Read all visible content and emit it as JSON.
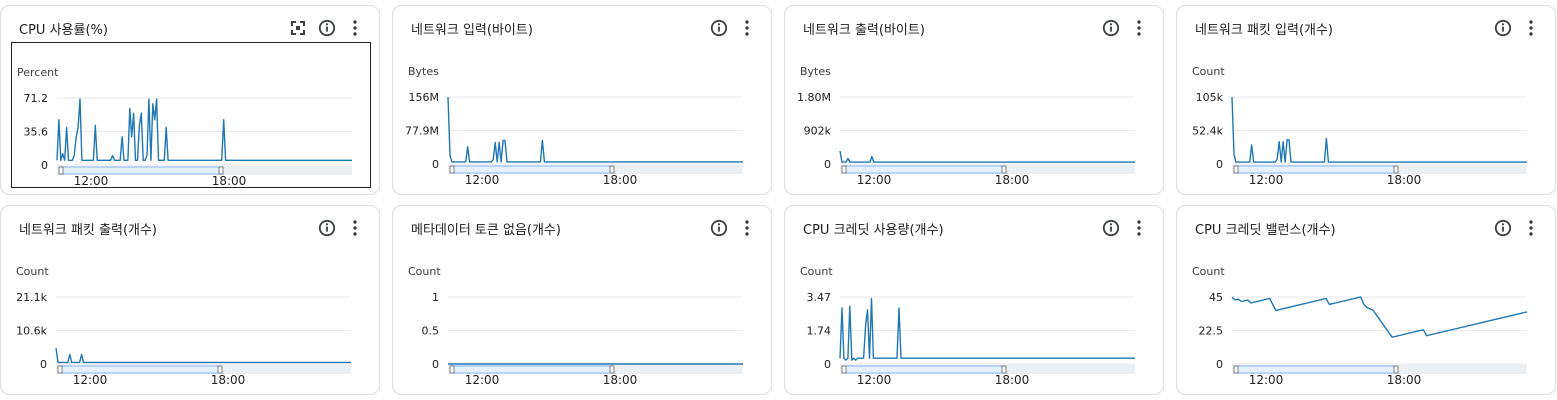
{
  "cards": [
    {
      "title": "CPU 사용률(%)",
      "has_fullscreen": true,
      "selected": true,
      "chart_data": {
        "type": "line",
        "ylabel": "Percent",
        "yticks": [
          "71.2",
          "35.6",
          "0"
        ],
        "ylim": [
          0,
          71.2
        ],
        "xticks": [
          "12:00",
          "18:00"
        ],
        "values": [
          5,
          48,
          5,
          12,
          5,
          40,
          5,
          5,
          5,
          10,
          30,
          40,
          70,
          5,
          5,
          5,
          5,
          5,
          5,
          5,
          42,
          5,
          5,
          5,
          5,
          5,
          5,
          5,
          5,
          10,
          5,
          5,
          5,
          5,
          30,
          5,
          5,
          5,
          60,
          30,
          55,
          5,
          5,
          42,
          55,
          5,
          5,
          10,
          70,
          5,
          65,
          48,
          70,
          5,
          5,
          5,
          5,
          40,
          5,
          5,
          5,
          5,
          5,
          5,
          5,
          5,
          5,
          5,
          5,
          5,
          5,
          5,
          5,
          5,
          5,
          5,
          5,
          5,
          5,
          5,
          5,
          5,
          5,
          5,
          5,
          5,
          5,
          48,
          5,
          5,
          5,
          5,
          5,
          5,
          5,
          5,
          5,
          5,
          5,
          5,
          5,
          5,
          5,
          5,
          5,
          5,
          5,
          5,
          5,
          5,
          5,
          5,
          5,
          5,
          5,
          5,
          5,
          5,
          5,
          5,
          5,
          5,
          5,
          5,
          5,
          5,
          5,
          5,
          5,
          5,
          5,
          5,
          5,
          5,
          5,
          5,
          5,
          5,
          5,
          5,
          5,
          5,
          5,
          5,
          5,
          5,
          5,
          5,
          5,
          5,
          5,
          5,
          5,
          5,
          5
        ]
      }
    },
    {
      "title": "네트워크 입력(바이트)",
      "has_fullscreen": false,
      "selected": false,
      "chart_data": {
        "type": "line",
        "ylabel": "Bytes",
        "yticks": [
          "156M",
          "77.9M",
          "0"
        ],
        "ylim": [
          0,
          156
        ],
        "xticks": [
          "12:00",
          "18:00"
        ],
        "values": [
          156,
          20,
          5,
          5,
          5,
          5,
          5,
          5,
          5,
          5,
          40,
          5,
          5,
          5,
          5,
          5,
          5,
          5,
          5,
          5,
          5,
          5,
          5,
          10,
          50,
          5,
          50,
          5,
          55,
          55,
          5,
          5,
          5,
          5,
          5,
          5,
          5,
          5,
          5,
          5,
          5,
          5,
          5,
          5,
          5,
          5,
          5,
          5,
          55,
          5,
          5,
          5,
          5,
          5,
          5,
          5,
          5,
          5,
          5,
          5,
          5,
          5,
          5,
          5,
          5,
          5,
          5,
          5,
          5,
          5,
          5,
          5,
          5,
          5,
          5,
          5,
          5,
          5,
          5,
          5,
          5,
          5,
          5,
          5,
          5,
          5,
          5,
          5,
          5,
          5,
          5,
          5,
          5,
          5,
          5,
          5,
          5,
          5,
          5,
          5,
          5,
          5,
          5,
          5,
          5,
          5,
          5,
          5,
          5,
          5,
          5,
          5,
          5,
          5,
          5,
          5,
          5,
          5,
          5,
          5,
          5,
          5,
          5,
          5,
          5,
          5,
          5,
          5,
          5,
          5,
          5,
          5,
          5,
          5,
          5,
          5,
          5,
          5,
          5,
          5,
          5,
          5,
          5,
          5,
          5,
          5,
          5,
          5,
          5,
          5,
          5
        ]
      }
    },
    {
      "title": "네트워크 출력(바이트)",
      "has_fullscreen": false,
      "selected": false,
      "chart_data": {
        "type": "line",
        "ylabel": "Bytes",
        "yticks": [
          "1.80M",
          "902k",
          "0"
        ],
        "ylim": [
          0,
          1.8
        ],
        "xticks": [
          "12:00",
          "18:00"
        ],
        "values": [
          0.35,
          0.05,
          0.05,
          0.05,
          0.15,
          0.05,
          0.05,
          0.05,
          0.05,
          0.05,
          0.05,
          0.05,
          0.05,
          0.05,
          0.05,
          0.05,
          0.2,
          0.05,
          0.05,
          0.05,
          0.05,
          0.05,
          0.05,
          0.05,
          0.05,
          0.05,
          0.05,
          0.05,
          0.05,
          0.05,
          0.05,
          0.05,
          0.05,
          0.05,
          0.05,
          0.05,
          0.05,
          0.05,
          0.05,
          0.05,
          0.05,
          0.05,
          0.05,
          0.05,
          0.05,
          0.05,
          0.05,
          0.05,
          0.05,
          0.05,
          0.05,
          0.05,
          0.05,
          0.05,
          0.05,
          0.05,
          0.05,
          0.05,
          0.05,
          0.05,
          0.05,
          0.05,
          0.05,
          0.05,
          0.05,
          0.05,
          0.05,
          0.05,
          0.05,
          0.05,
          0.05,
          0.05,
          0.05,
          0.05,
          0.05,
          0.05,
          0.05,
          0.05,
          0.05,
          0.05,
          0.05,
          0.05,
          0.05,
          0.05,
          0.05,
          0.05,
          0.05,
          0.05,
          0.05,
          0.05,
          0.05,
          0.05,
          0.05,
          0.05,
          0.05,
          0.05,
          0.05,
          0.05,
          0.05,
          0.05,
          0.05,
          0.05,
          0.05,
          0.05,
          0.05,
          0.05,
          0.05,
          0.05,
          0.05,
          0.05,
          0.05,
          0.05,
          0.05,
          0.05,
          0.05,
          0.05,
          0.05,
          0.05,
          0.05,
          0.05,
          0.05,
          0.05,
          0.05,
          0.05,
          0.05,
          0.05,
          0.05,
          0.05,
          0.05,
          0.05,
          0.05,
          0.05,
          0.05,
          0.05,
          0.05,
          0.05,
          0.05,
          0.05,
          0.05,
          0.05,
          0.05,
          0.05,
          0.05,
          0.05,
          0.05,
          0.05,
          0.05,
          0.05,
          0.05
        ]
      }
    },
    {
      "title": "네트워크 패킷 입력(개수)",
      "has_fullscreen": false,
      "selected": false,
      "chart_data": {
        "type": "line",
        "ylabel": "Count",
        "yticks": [
          "105k",
          "52.4k",
          "0"
        ],
        "ylim": [
          0,
          105
        ],
        "xticks": [
          "12:00",
          "18:00"
        ],
        "values": [
          105,
          15,
          3,
          3,
          3,
          3,
          3,
          3,
          3,
          3,
          30,
          3,
          3,
          3,
          3,
          3,
          3,
          3,
          3,
          3,
          3,
          3,
          3,
          8,
          35,
          3,
          35,
          3,
          38,
          38,
          3,
          3,
          3,
          3,
          3,
          3,
          3,
          3,
          3,
          3,
          3,
          3,
          3,
          3,
          3,
          3,
          3,
          3,
          40,
          3,
          3,
          3,
          3,
          3,
          3,
          3,
          3,
          3,
          3,
          3,
          3,
          3,
          3,
          3,
          3,
          3,
          3,
          3,
          3,
          3,
          3,
          3,
          3,
          3,
          3,
          3,
          3,
          3,
          3,
          3,
          3,
          3,
          3,
          3,
          3,
          3,
          3,
          3,
          3,
          3,
          3,
          3,
          3,
          3,
          3,
          3,
          3,
          3,
          3,
          3,
          3,
          3,
          3,
          3,
          3,
          3,
          3,
          3,
          3,
          3,
          3,
          3,
          3,
          3,
          3,
          3,
          3,
          3,
          3,
          3,
          3,
          3,
          3,
          3,
          3,
          3,
          3,
          3,
          3,
          3,
          3,
          3,
          3,
          3,
          3,
          3,
          3,
          3,
          3,
          3,
          3,
          3,
          3,
          3,
          3,
          3,
          3,
          3,
          3,
          3,
          3
        ]
      }
    },
    {
      "title": "네트워크 패킷 출력(개수)",
      "has_fullscreen": false,
      "selected": false,
      "chart_data": {
        "type": "line",
        "ylabel": "Count",
        "yticks": [
          "21.1k",
          "10.6k",
          "0"
        ],
        "ylim": [
          0,
          21.1
        ],
        "xticks": [
          "12:00",
          "18:00"
        ],
        "values": [
          5,
          0.5,
          0.5,
          0.5,
          0.5,
          0.5,
          0.5,
          3,
          0.5,
          0.5,
          0.5,
          0.5,
          0.5,
          3,
          0.5,
          0.5,
          0.5,
          0.5,
          0.5,
          0.5,
          0.5,
          0.5,
          0.5,
          0.5,
          0.5,
          0.5,
          0.5,
          0.5,
          0.5,
          0.5,
          0.5,
          0.5,
          0.5,
          0.5,
          0.5,
          0.5,
          0.5,
          0.5,
          0.5,
          0.5,
          0.5,
          0.5,
          0.5,
          0.5,
          0.5,
          0.5,
          0.5,
          0.5,
          0.5,
          0.5,
          0.5,
          0.5,
          0.5,
          0.5,
          0.5,
          0.5,
          0.5,
          0.5,
          0.5,
          0.5,
          0.5,
          0.5,
          0.5,
          0.5,
          0.5,
          0.5,
          0.5,
          0.5,
          0.5,
          0.5,
          0.5,
          0.5,
          0.5,
          0.5,
          0.5,
          0.5,
          0.5,
          0.5,
          0.5,
          0.5,
          0.5,
          0.5,
          0.5,
          0.5,
          0.5,
          0.5,
          0.5,
          0.5,
          0.5,
          0.5,
          0.5,
          0.5,
          0.5,
          0.5,
          0.5,
          0.5,
          0.5,
          0.5,
          0.5,
          0.5,
          0.5,
          0.5,
          0.5,
          0.5,
          0.5,
          0.5,
          0.5,
          0.5,
          0.5,
          0.5,
          0.5,
          0.5,
          0.5,
          0.5,
          0.5,
          0.5,
          0.5,
          0.5,
          0.5,
          0.5,
          0.5,
          0.5,
          0.5,
          0.5,
          0.5,
          0.5,
          0.5,
          0.5,
          0.5,
          0.5,
          0.5,
          0.5,
          0.5,
          0.5,
          0.5,
          0.5,
          0.5,
          0.5,
          0.5,
          0.5,
          0.5,
          0.5,
          0.5,
          0.5,
          0.5,
          0.5,
          0.5,
          0.5,
          0.5,
          0.5,
          0.5
        ]
      }
    },
    {
      "title": "메타데이터 토큰 없음(개수)",
      "has_fullscreen": false,
      "selected": false,
      "chart_data": {
        "type": "line",
        "ylabel": "Count",
        "yticks": [
          "1",
          "0.5",
          "0"
        ],
        "ylim": [
          0,
          1
        ],
        "xticks": [
          "12:00",
          "18:00"
        ],
        "values": [
          0,
          0,
          0,
          0,
          0,
          0,
          0,
          0,
          0,
          0,
          0,
          0,
          0,
          0,
          0,
          0,
          0,
          0,
          0,
          0,
          0,
          0,
          0,
          0,
          0,
          0,
          0,
          0,
          0,
          0,
          0,
          0,
          0,
          0,
          0,
          0,
          0,
          0,
          0,
          0,
          0,
          0,
          0,
          0,
          0,
          0,
          0,
          0,
          0,
          0,
          0,
          0,
          0,
          0,
          0,
          0,
          0,
          0,
          0,
          0,
          0,
          0,
          0,
          0,
          0,
          0,
          0,
          0,
          0,
          0,
          0,
          0,
          0,
          0,
          0,
          0,
          0,
          0,
          0,
          0,
          0,
          0,
          0,
          0,
          0,
          0,
          0,
          0,
          0,
          0,
          0,
          0,
          0,
          0,
          0,
          0,
          0,
          0,
          0,
          0,
          0,
          0,
          0,
          0,
          0,
          0,
          0,
          0,
          0,
          0,
          0,
          0,
          0,
          0,
          0,
          0,
          0,
          0,
          0,
          0,
          0,
          0,
          0,
          0,
          0,
          0,
          0,
          0,
          0,
          0,
          0,
          0,
          0,
          0,
          0,
          0,
          0,
          0,
          0,
          0,
          0,
          0,
          0,
          0,
          0,
          0,
          0,
          0,
          0,
          0,
          0
        ]
      }
    },
    {
      "title": "CPU 크레딧 사용량(개수)",
      "has_fullscreen": false,
      "selected": false,
      "chart_data": {
        "type": "line",
        "ylabel": "Count",
        "yticks": [
          "3.47",
          "1.74",
          "0"
        ],
        "ylim": [
          0,
          3.47
        ],
        "xticks": [
          "12:00",
          "18:00"
        ],
        "values": [
          0.3,
          2.9,
          0.3,
          0.2,
          0.3,
          3.0,
          0.2,
          0.3,
          0.2,
          0.3,
          0.3,
          0.3,
          0.3,
          2.0,
          2.8,
          0.3,
          3.4,
          0.3,
          0.3,
          0.3,
          0.3,
          0.3,
          0.3,
          0.3,
          0.3,
          0.3,
          0.3,
          0.3,
          0.3,
          0.3,
          2.9,
          0.3,
          0.3,
          0.3,
          0.3,
          0.3,
          0.3,
          0.3,
          0.3,
          0.3,
          0.3,
          0.3,
          0.3,
          0.3,
          0.3,
          0.3,
          0.3,
          0.3,
          0.3,
          0.3,
          0.3,
          0.3,
          0.3,
          0.3,
          0.3,
          0.3,
          0.3,
          0.3,
          0.3,
          0.3,
          0.3,
          0.3,
          0.3,
          0.3,
          0.3,
          0.3,
          0.3,
          0.3,
          0.3,
          0.3,
          0.3,
          0.3,
          0.3,
          0.3,
          0.3,
          0.3,
          0.3,
          0.3,
          0.3,
          0.3,
          0.3,
          0.3,
          0.3,
          0.3,
          0.3,
          0.3,
          0.3,
          0.3,
          0.3,
          0.3,
          0.3,
          0.3,
          0.3,
          0.3,
          0.3,
          0.3,
          0.3,
          0.3,
          0.3,
          0.3,
          0.3,
          0.3,
          0.3,
          0.3,
          0.3,
          0.3,
          0.3,
          0.3,
          0.3,
          0.3,
          0.3,
          0.3,
          0.3,
          0.3,
          0.3,
          0.3,
          0.3,
          0.3,
          0.3,
          0.3,
          0.3,
          0.3,
          0.3,
          0.3,
          0.3,
          0.3,
          0.3,
          0.3,
          0.3,
          0.3,
          0.3,
          0.3,
          0.3,
          0.3,
          0.3,
          0.3,
          0.3,
          0.3,
          0.3,
          0.3,
          0.3,
          0.3,
          0.3,
          0.3,
          0.3,
          0.3,
          0.3,
          0.3,
          0.3,
          0.3,
          0.3
        ]
      }
    },
    {
      "title": "CPU 크레딧 밸런스(개수)",
      "has_fullscreen": false,
      "selected": false,
      "chart_data": {
        "type": "line",
        "ylabel": "Count",
        "yticks": [
          "45",
          "22.5",
          "0"
        ],
        "ylim": [
          0,
          45
        ],
        "xticks": [
          "12:00",
          "18:00"
        ],
        "values": [
          45,
          43,
          43.5,
          42,
          42.5,
          43,
          41,
          41.5,
          42,
          42.5,
          43,
          43.5,
          44,
          40,
          36,
          36.5,
          37,
          37.5,
          38,
          38.5,
          39,
          39.5,
          40,
          40.5,
          41,
          41.5,
          42,
          42.5,
          43,
          43.5,
          44,
          40,
          40.5,
          41,
          41.5,
          42,
          42.5,
          43,
          43.5,
          44,
          44.5,
          45,
          40,
          38,
          37,
          36,
          33,
          30,
          27,
          24,
          21,
          18,
          18.5,
          19,
          19.5,
          20,
          20.5,
          21,
          21.5,
          22,
          22.5,
          23,
          19,
          19.5,
          20,
          20.5,
          21,
          21.5,
          22,
          22.5,
          23,
          23.5,
          24,
          24.5,
          25,
          25.5,
          26,
          26.5,
          27,
          27.5,
          28,
          28.5,
          29,
          29.5,
          30,
          30.5,
          31,
          31.5,
          32,
          32.5,
          33,
          33.5,
          34,
          34.5,
          35
        ]
      }
    }
  ],
  "colors": {
    "line": "#1a73e8",
    "series": "#1f77b4",
    "grid": "#e8eaed",
    "icon": "#3c4043"
  }
}
